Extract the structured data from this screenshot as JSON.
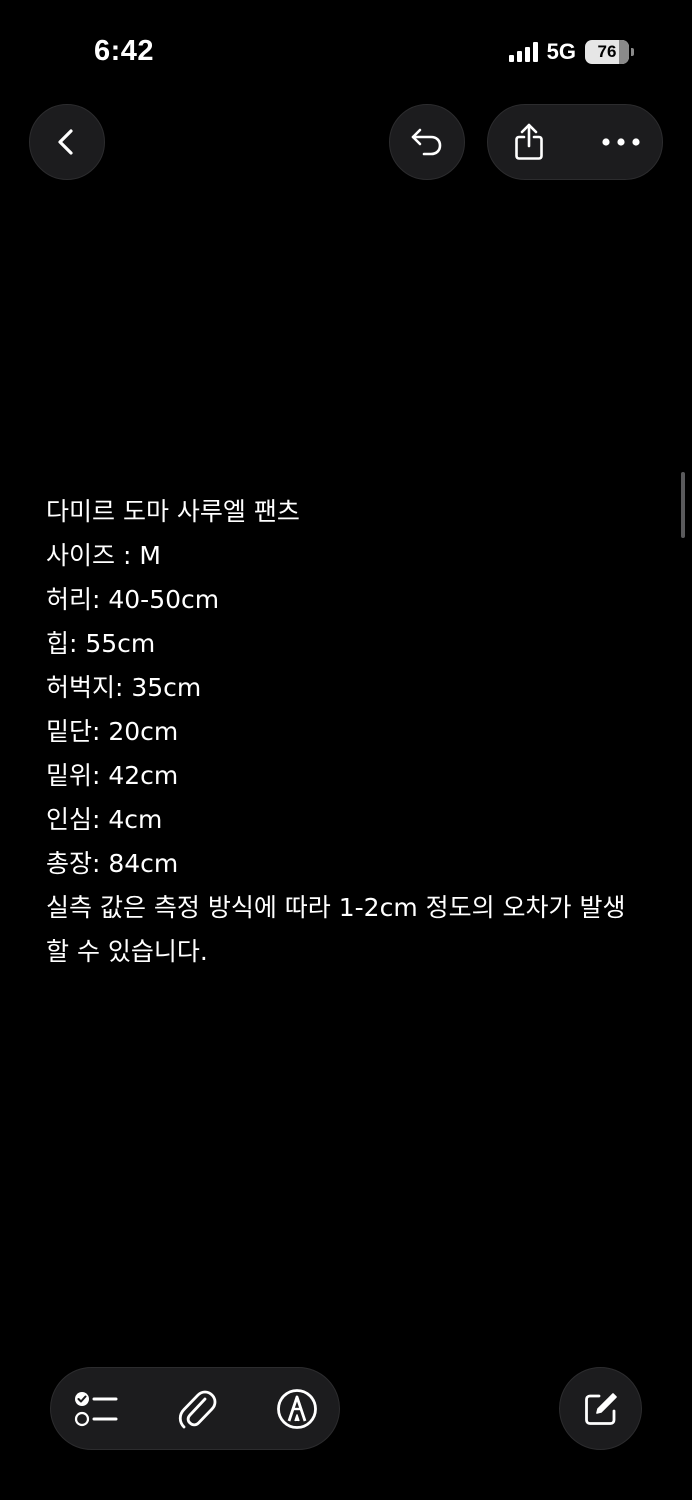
{
  "status_bar": {
    "time": "6:42",
    "network": "5G",
    "battery": "76"
  },
  "toolbar": {
    "back_icon": "chevron-left-icon",
    "undo_icon": "undo-icon",
    "share_icon": "share-icon",
    "more_icon": "ellipsis-icon"
  },
  "note": {
    "lines": [
      "다미르 도마 사루엘 팬츠",
      "사이즈 : M",
      "허리: 40-50cm",
      "힙: 55cm",
      "허벅지: 35cm",
      "밑단: 20cm",
      "밑위: 42cm",
      "인심: 4cm",
      "총장: 84cm",
      "실측 값은 측정 방식에 따라 1-2cm 정도의 오차가 발생할 수 있습니다."
    ]
  },
  "bottom_toolbar": {
    "checklist_icon": "checklist-icon",
    "attachment_icon": "paperclip-icon",
    "markup_icon": "markup-pen-icon",
    "compose_icon": "compose-icon"
  },
  "colors": {
    "background": "#000000",
    "button_fill": "#1c1c1e",
    "text": "#ffffff"
  }
}
